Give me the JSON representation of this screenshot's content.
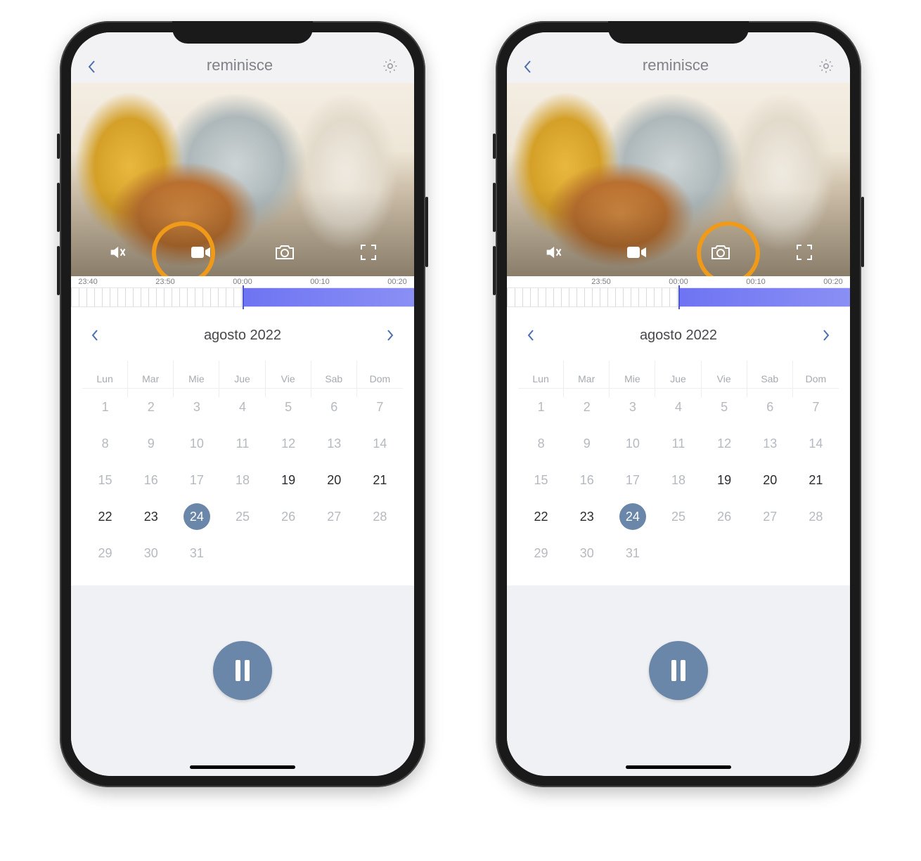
{
  "app": {
    "title": "reminisce"
  },
  "video_controls": {
    "mute": "mute-icon",
    "record": "video-record-icon",
    "snapshot": "camera-icon",
    "fullscreen": "fullscreen-icon"
  },
  "timeline": {
    "labels_left_phone": [
      "23:40",
      "23:50",
      "00:00",
      "00:10",
      "00:20"
    ],
    "labels_right_phone": [
      "",
      "23:50",
      "00:00",
      "00:10",
      "00:20"
    ]
  },
  "month_nav": {
    "label": "agosto 2022"
  },
  "calendar": {
    "weekdays": [
      "Lun",
      "Mar",
      "Mie",
      "Jue",
      "Vie",
      "Sab",
      "Dom"
    ],
    "weeks": [
      [
        {
          "n": "1",
          "s": "dim"
        },
        {
          "n": "2",
          "s": "dim"
        },
        {
          "n": "3",
          "s": "dim"
        },
        {
          "n": "4",
          "s": "dim"
        },
        {
          "n": "5",
          "s": "dim"
        },
        {
          "n": "6",
          "s": "dim"
        },
        {
          "n": "7",
          "s": "dim"
        }
      ],
      [
        {
          "n": "8",
          "s": "dim"
        },
        {
          "n": "9",
          "s": "dim"
        },
        {
          "n": "10",
          "s": "dim"
        },
        {
          "n": "11",
          "s": "dim"
        },
        {
          "n": "12",
          "s": "dim"
        },
        {
          "n": "13",
          "s": "dim"
        },
        {
          "n": "14",
          "s": "dim"
        }
      ],
      [
        {
          "n": "15",
          "s": "dim"
        },
        {
          "n": "16",
          "s": "dim"
        },
        {
          "n": "17",
          "s": "dim"
        },
        {
          "n": "18",
          "s": "dim"
        },
        {
          "n": "19",
          "s": "dark"
        },
        {
          "n": "20",
          "s": "dark"
        },
        {
          "n": "21",
          "s": "dark"
        }
      ],
      [
        {
          "n": "22",
          "s": "dark"
        },
        {
          "n": "23",
          "s": "dark"
        },
        {
          "n": "24",
          "s": "sel"
        },
        {
          "n": "25",
          "s": "dim"
        },
        {
          "n": "26",
          "s": "dim"
        },
        {
          "n": "27",
          "s": "dim"
        },
        {
          "n": "28",
          "s": "dim"
        }
      ],
      [
        {
          "n": "29",
          "s": "dim"
        },
        {
          "n": "30",
          "s": "dim"
        },
        {
          "n": "31",
          "s": "dim"
        },
        {
          "n": "",
          "s": ""
        },
        {
          "n": "",
          "s": ""
        },
        {
          "n": "",
          "s": ""
        },
        {
          "n": "",
          "s": ""
        }
      ]
    ]
  },
  "phones": [
    {
      "highlight": "record"
    },
    {
      "highlight": "snapshot"
    }
  ]
}
